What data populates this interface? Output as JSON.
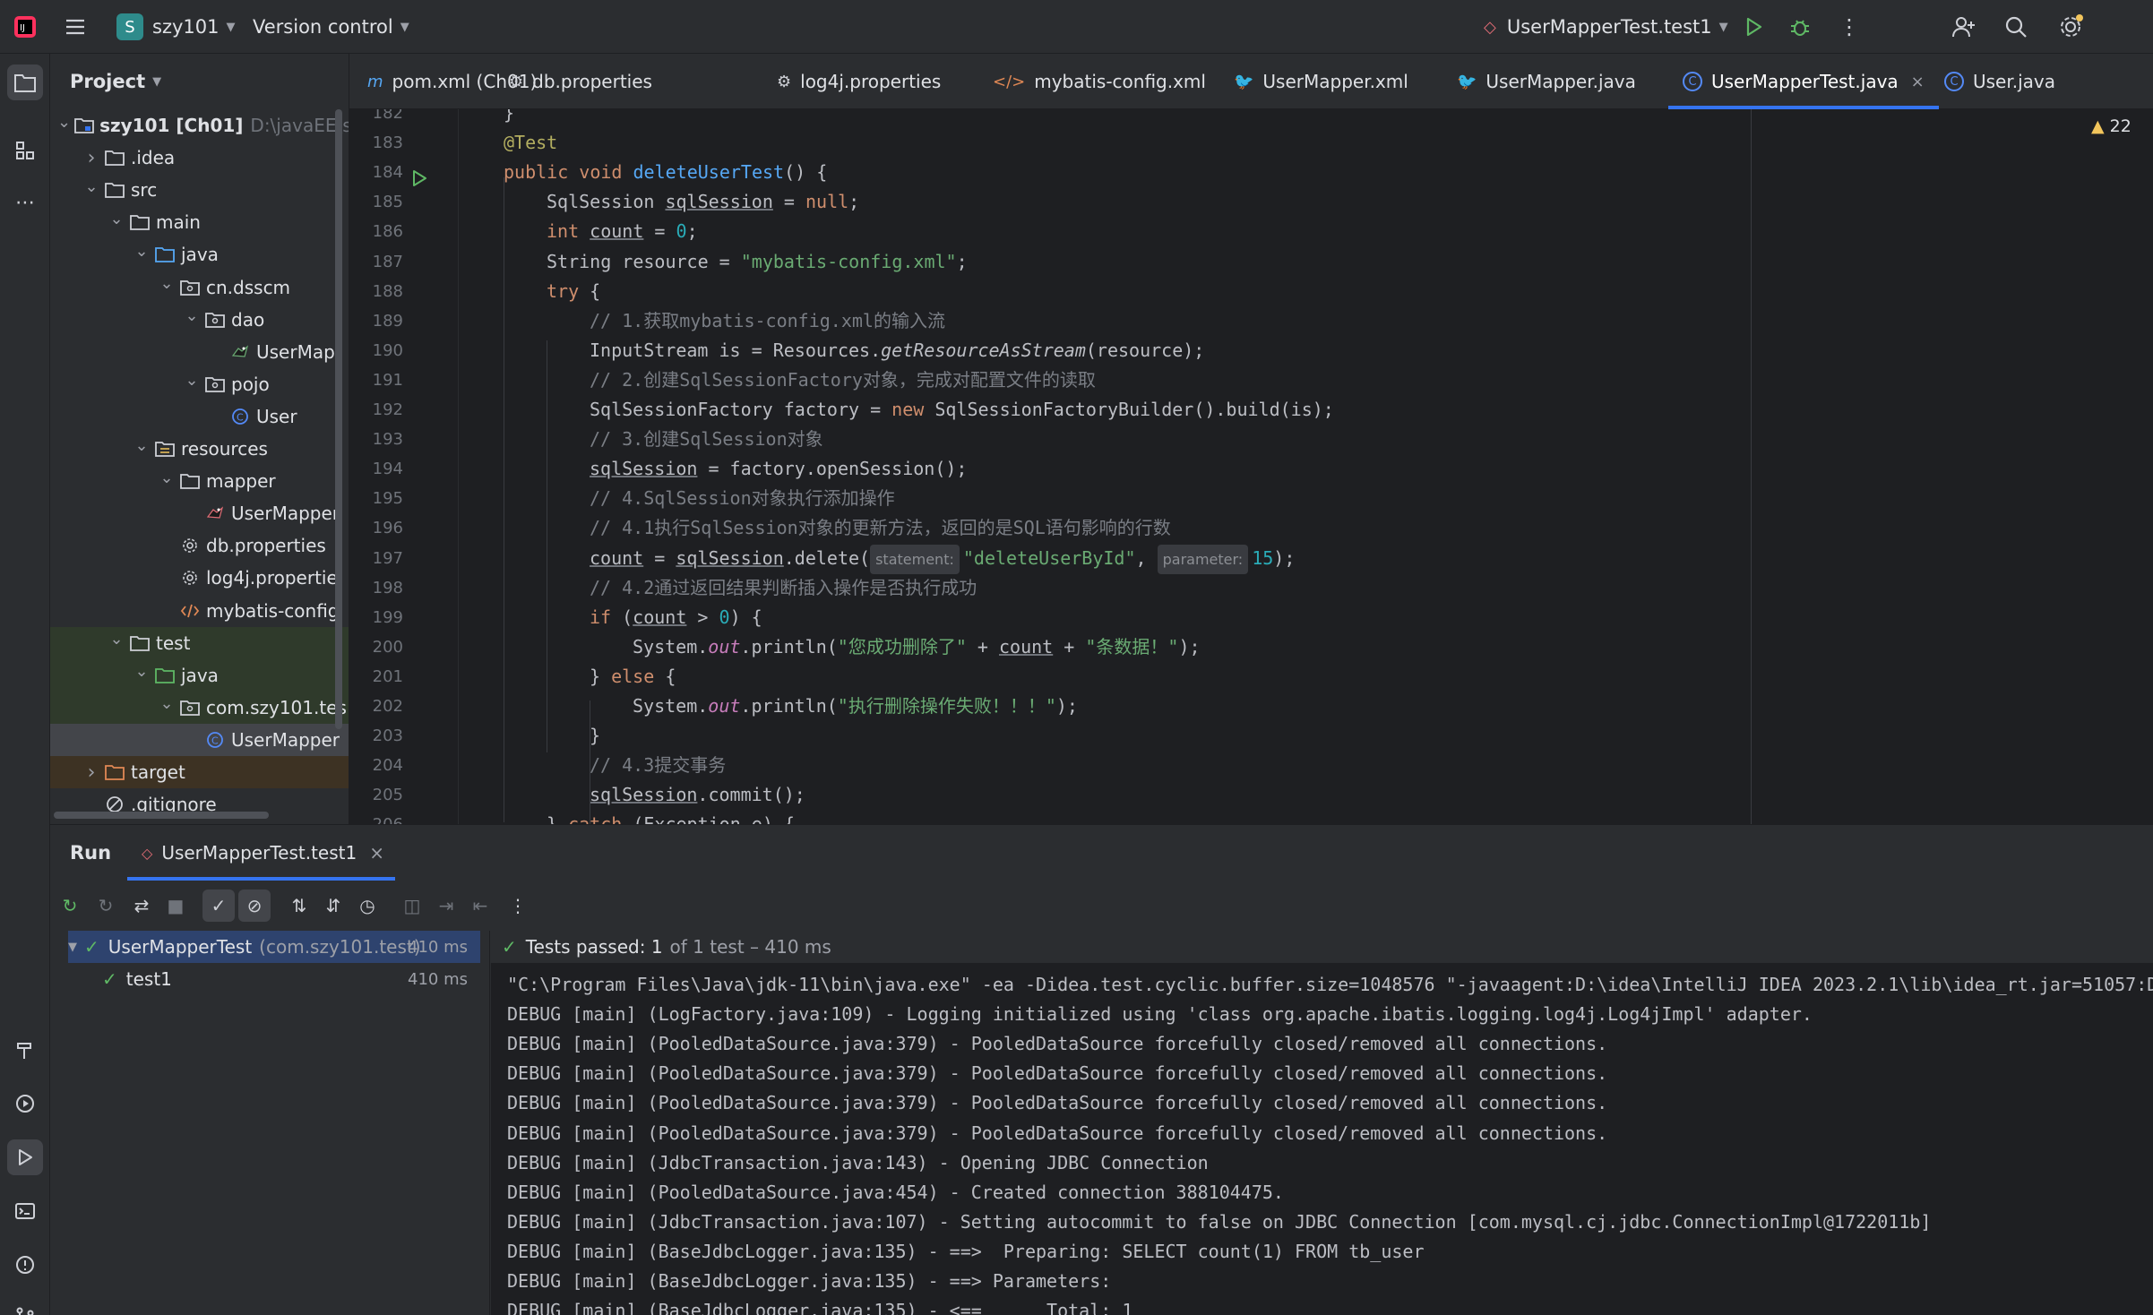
{
  "titlebar": {
    "project_badge": "S",
    "project_name": "szy101",
    "vcs": "Version control",
    "run_config": "UserMapperTest.test1"
  },
  "project_panel": {
    "title": "Project",
    "tree": [
      {
        "label": "szy101 [Ch01]",
        "hint": "D:\\javaEE\\s",
        "icon": "module-folder-icon",
        "arrow": "v",
        "level": 0,
        "bold": true
      },
      {
        "label": ".idea",
        "icon": "folder-icon",
        "arrow": ">",
        "level": 1
      },
      {
        "label": "src",
        "icon": "folder-icon",
        "arrow": "v",
        "level": 1
      },
      {
        "label": "main",
        "icon": "folder-icon",
        "arrow": "v",
        "level": 2
      },
      {
        "label": "java",
        "icon": "source-folder-icon",
        "arrow": "v",
        "level": 3
      },
      {
        "label": "cn.dsscm",
        "icon": "package-icon",
        "arrow": "v",
        "level": 4
      },
      {
        "label": "dao",
        "icon": "package-icon",
        "arrow": "v",
        "level": 5
      },
      {
        "label": "UserMap",
        "icon": "mapper-interface-icon",
        "arrow": "",
        "level": 6
      },
      {
        "label": "pojo",
        "icon": "package-icon",
        "arrow": "v",
        "level": 5
      },
      {
        "label": "User",
        "icon": "class-icon",
        "arrow": "",
        "level": 6
      },
      {
        "label": "resources",
        "icon": "resources-folder-icon",
        "arrow": "v",
        "level": 3
      },
      {
        "label": "mapper",
        "icon": "folder-icon",
        "arrow": "v",
        "level": 4
      },
      {
        "label": "UserMapper",
        "icon": "mybatis-xml-icon",
        "arrow": "",
        "level": 5
      },
      {
        "label": "db.properties",
        "icon": "properties-icon",
        "arrow": "",
        "level": 4
      },
      {
        "label": "log4j.propertie",
        "icon": "properties-icon",
        "arrow": "",
        "level": 4
      },
      {
        "label": "mybatis-config",
        "icon": "xml-icon",
        "arrow": "",
        "level": 4
      },
      {
        "label": "test",
        "icon": "folder-icon",
        "arrow": "v",
        "level": 2
      },
      {
        "label": "java",
        "icon": "test-source-folder-icon",
        "arrow": "v",
        "level": 3
      },
      {
        "label": "com.szy101.tes",
        "icon": "package-icon",
        "arrow": "v",
        "level": 4
      },
      {
        "label": "UserMapper",
        "icon": "class-icon",
        "arrow": "",
        "level": 5
      },
      {
        "label": "target",
        "icon": "excluded-folder-icon",
        "arrow": ">",
        "level": 1
      },
      {
        "label": ".gitignore",
        "icon": "ignore-file-icon",
        "arrow": "",
        "level": 1
      }
    ]
  },
  "tabs": [
    {
      "label": "pom.xml (Ch01)",
      "icon": "maven-icon",
      "glyph": "m"
    },
    {
      "label": "db.properties",
      "icon": "properties-icon",
      "glyph": "⚙"
    },
    {
      "label": "log4j.properties",
      "icon": "properties-icon",
      "glyph": "⚙"
    },
    {
      "label": "mybatis-config.xml",
      "icon": "xml-icon",
      "glyph": "</>"
    },
    {
      "label": "UserMapper.xml",
      "icon": "mybatis-xml-icon",
      "glyph": "🐦"
    },
    {
      "label": "UserMapper.java",
      "icon": "mapper-interface-icon",
      "glyph": "🐦"
    },
    {
      "label": "UserMapperTest.java",
      "icon": "class-icon",
      "glyph": "C",
      "active": true
    },
    {
      "label": "User.java",
      "icon": "class-icon",
      "glyph": "C"
    }
  ],
  "editor": {
    "warning_count": "22",
    "line_numbers": [
      "182",
      "183",
      "184",
      "185",
      "186",
      "187",
      "188",
      "189",
      "190",
      "191",
      "192",
      "193",
      "194",
      "195",
      "196",
      "197",
      "198",
      "199",
      "200",
      "201",
      "202",
      "203",
      "204",
      "205",
      "206"
    ],
    "strings": {
      "resource": "\"mybatis-config.xml\"",
      "c1": "// 1.获取mybatis-config.xml的输入流",
      "c2": "// 2.创建SqlSessionFactory对象，完成对配置文件的读取",
      "c3": "// 3.创建SqlSession对象",
      "c4": "// 4.SqlSession对象执行添加操作",
      "c41": "// 4.1执行SqlSession对象的更新方法，返回的是SQL语句影响的行数",
      "hint_statement": "statement:",
      "stmt": "\"deleteUserById\"",
      "hint_parameter": "parameter:",
      "param": "15",
      "c42": "// 4.2通过返回结果判断插入操作是否执行成功",
      "ok1": "\"您成功删除了\"",
      "ok2": "\"条数据！\"",
      "fail": "\"执行删除操作失败！！！\"",
      "c43": "// 4.3提交事务"
    }
  },
  "run_panel": {
    "title": "Run",
    "tab_label": "UserMapperTest.test1",
    "status_main": "Tests passed: 1",
    "status_rest": "of 1 test – 410 ms",
    "tests": [
      {
        "name": "UserMapperTest",
        "pkg": "(com.szy101.test)",
        "time": "410 ms"
      },
      {
        "name": "test1",
        "pkg": "",
        "time": "410 ms"
      }
    ],
    "console": [
      "\"C:\\Program Files\\Java\\jdk-11\\bin\\java.exe\" -ea -Didea.test.cyclic.buffer.size=1048576 \"-javaagent:D:\\idea\\IntelliJ IDEA 2023.2.1\\lib\\idea_rt.jar=51057:D",
      "DEBUG [main] (LogFactory.java:109) - Logging initialized using 'class org.apache.ibatis.logging.log4j.Log4jImpl' adapter.",
      "DEBUG [main] (PooledDataSource.java:379) - PooledDataSource forcefully closed/removed all connections.",
      "DEBUG [main] (PooledDataSource.java:379) - PooledDataSource forcefully closed/removed all connections.",
      "DEBUG [main] (PooledDataSource.java:379) - PooledDataSource forcefully closed/removed all connections.",
      "DEBUG [main] (PooledDataSource.java:379) - PooledDataSource forcefully closed/removed all connections.",
      "DEBUG [main] (JdbcTransaction.java:143) - Opening JDBC Connection",
      "DEBUG [main] (PooledDataSource.java:454) - Created connection 388104475.",
      "DEBUG [main] (JdbcTransaction.java:107) - Setting autocommit to false on JDBC Connection [com.mysql.cj.jdbc.ConnectionImpl@1722011b]",
      "DEBUG [main] (BaseJdbcLogger.java:135) - ==>  Preparing: SELECT count(1) FROM tb_user",
      "DEBUG [main] (BaseJdbcLogger.java:135) - ==> Parameters: ",
      "DEBUG [main] (BaseJdbcLogger.java:135) - <==      Total: 1"
    ]
  },
  "colors": {
    "accent": "#3574f0",
    "pass_green": "#5fb865",
    "keyword": "#cf8e6d",
    "string": "#6aab73"
  }
}
